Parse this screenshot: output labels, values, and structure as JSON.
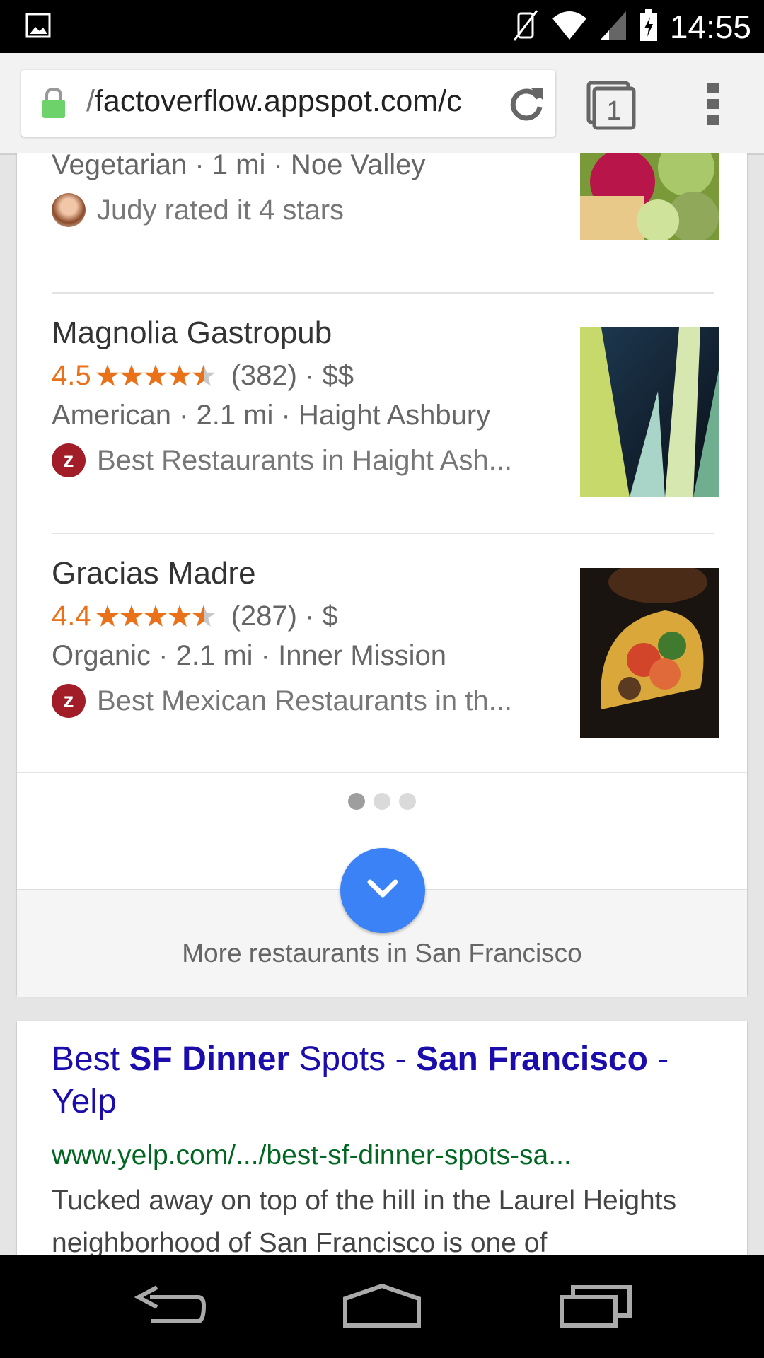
{
  "status_bar": {
    "time": "14:55"
  },
  "browser": {
    "url_prefix": "/",
    "url_main": "factoverflow.appspot.com/c",
    "tab_count": "1"
  },
  "results": [
    {
      "name": "",
      "line2": "Vegetarian · 1 mi · Noe Valley",
      "attribution": "Judy rated it 4 stars"
    },
    {
      "name": "Magnolia Gastropub",
      "rating": "4.5",
      "stars": 4.5,
      "reviews": "(382) · $$",
      "line2": "American · 2.1 mi · Haight Ashbury",
      "attribution": "Best Restaurants in Haight Ash..."
    },
    {
      "name": "Gracias Madre",
      "rating": "4.4",
      "stars": 4.5,
      "reviews": "(287) · $",
      "line2": "Organic · 2.1 mi · Inner Mission",
      "attribution": "Best Mexican Restaurants in th..."
    }
  ],
  "pagination": {
    "pages": 3,
    "current": 1
  },
  "more_link": "More restaurants in San Francisco",
  "web_result": {
    "title_parts": [
      "Best ",
      "SF Dinner",
      " Spots - ",
      "San Francisco",
      " - Yelp"
    ],
    "url": "www.yelp.com/.../best-sf-dinner-spots-sa...",
    "snippet": "Tucked away on top of the hill in the Laurel Heights neighborhood of San Francisco is one of"
  },
  "colors": {
    "accent": "#3b82f6",
    "star": "#e8711a",
    "link": "#1a0dab",
    "url_green": "#006621",
    "zagat": "#a11d27"
  }
}
